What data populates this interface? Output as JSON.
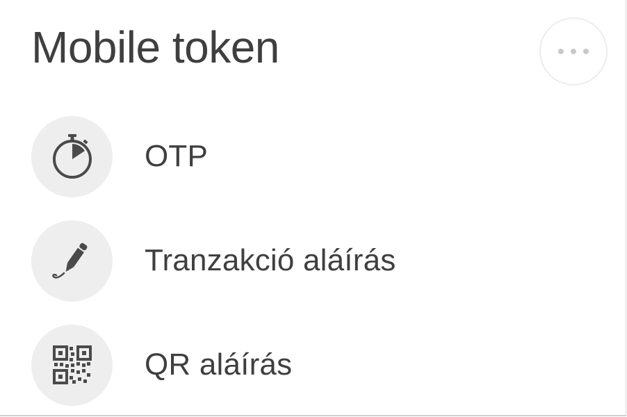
{
  "header": {
    "title": "Mobile token"
  },
  "menu": {
    "more_icon": "more-horizontal-icon",
    "items": [
      {
        "label": "OTP",
        "icon": "stopwatch-icon"
      },
      {
        "label": "Tranzakció aláírás",
        "icon": "pen-icon"
      },
      {
        "label": "QR aláírás",
        "icon": "qr-code-icon"
      }
    ]
  },
  "colors": {
    "text": "#3f3f3f",
    "icon": "#4a4a4a",
    "icon_background": "#eeeeee",
    "more_dots": "#c9c9c9"
  }
}
